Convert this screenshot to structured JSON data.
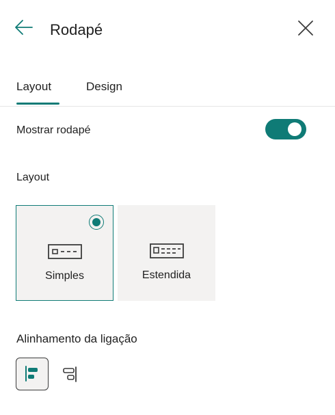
{
  "header": {
    "title": "Rodapé",
    "back_icon": "arrow-left-icon",
    "close_icon": "close-icon"
  },
  "tabs": [
    {
      "label": "Layout",
      "selected": true
    },
    {
      "label": "Design",
      "selected": false
    }
  ],
  "footer_toggle": {
    "label": "Mostrar rodapé",
    "on": true
  },
  "layout_section": {
    "label": "Layout",
    "options": [
      {
        "label": "Simples",
        "selected": true,
        "icon": "footer-simple-layout-icon"
      },
      {
        "label": "Estendida",
        "selected": false,
        "icon": "footer-extended-layout-icon"
      }
    ]
  },
  "alignment_section": {
    "label": "Alinhamento da ligação",
    "options": [
      {
        "icon": "align-left-icon",
        "selected": true
      },
      {
        "icon": "align-right-icon",
        "selected": false
      }
    ]
  },
  "colors": {
    "accent": "#0f7b76",
    "card_bg": "#f3f2f1",
    "text": "#1f1f1f"
  }
}
